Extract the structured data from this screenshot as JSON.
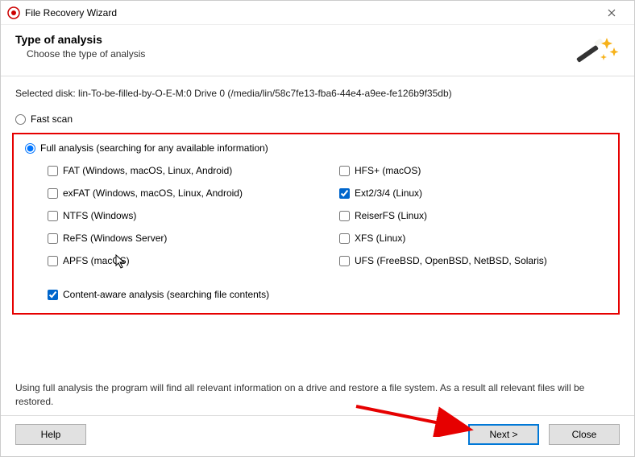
{
  "titlebar": {
    "title": "File Recovery Wizard"
  },
  "header": {
    "title": "Type of analysis",
    "subtitle": "Choose the type of analysis"
  },
  "selected_disk": "Selected disk: lin-To-be-filled-by-O-E-M:0 Drive 0 (/media/lin/58c7fe13-fba6-44e4-a9ee-fe126b9f35db)",
  "scan_options": {
    "fast": "Fast scan",
    "full": "Full analysis (searching for any available information)"
  },
  "filesystems": {
    "left": [
      "FAT (Windows, macOS, Linux, Android)",
      "exFAT (Windows, macOS, Linux, Android)",
      "NTFS (Windows)",
      "ReFS (Windows Server)",
      "APFS (macOS)"
    ],
    "right": [
      "HFS+ (macOS)",
      "Ext2/3/4 (Linux)",
      "ReiserFS (Linux)",
      "XFS (Linux)",
      "UFS (FreeBSD, OpenBSD, NetBSD, Solaris)"
    ]
  },
  "content_aware": "Content-aware analysis (searching file contents)",
  "info": "Using full analysis the program will find all relevant information on a drive and restore a file system. As a result all relevant files will be restored.",
  "buttons": {
    "help": "Help",
    "next": "Next >",
    "close": "Close"
  }
}
